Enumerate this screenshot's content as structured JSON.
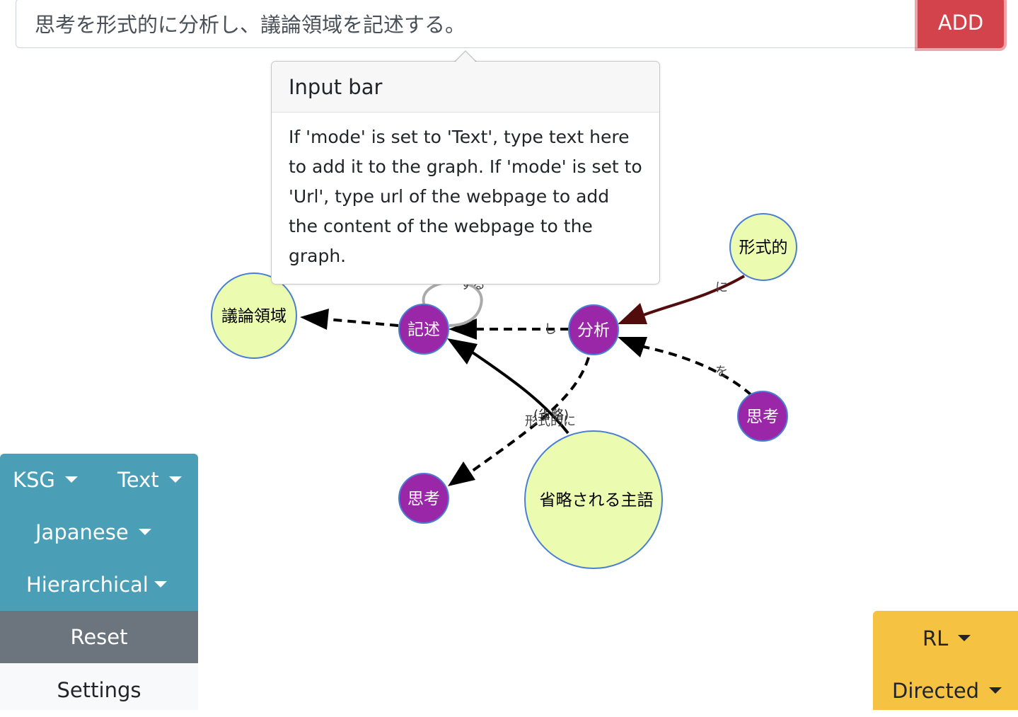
{
  "input_bar": {
    "value": "思考を形式的に分析し、議論領域を記述する。",
    "add_label": "ADD",
    "accent_color": "#d2434b"
  },
  "popover": {
    "title": "Input bar",
    "body": "If 'mode' is set to 'Text', type text here to add it to the graph. If 'mode' is set to 'Url', type url of the webpage to add the content of the webpage to the graph."
  },
  "graph": {
    "nodes": {
      "keishikiteki": "形式的",
      "giron": "議論領域",
      "kijutsu": "記述",
      "bunseki": "分析",
      "shikou_right": "思考",
      "shikou_left": "思考",
      "shouryaku": "省略される主語"
    },
    "edge_labels": {
      "ni_top": "に",
      "suru": "する",
      "shi": "し",
      "wo": "を",
      "shouryaku": "(省略)",
      "keishikiteki_ni": "形式的に"
    },
    "colors": {
      "concept_node": "#ebfbb0",
      "predicate_node": "#9a27a8",
      "node_border": "#4a7fd4",
      "modifier_edge": "#520c0c"
    }
  },
  "left_panel": {
    "ksg": "KSG",
    "mode": "Text",
    "language": "Japanese",
    "layout": "Hierarchical",
    "reset": "Reset",
    "settings": "Settings",
    "color": "#4a9eb5"
  },
  "right_panel": {
    "direction": "RL",
    "edge_type": "Directed",
    "color": "#f5c242"
  }
}
